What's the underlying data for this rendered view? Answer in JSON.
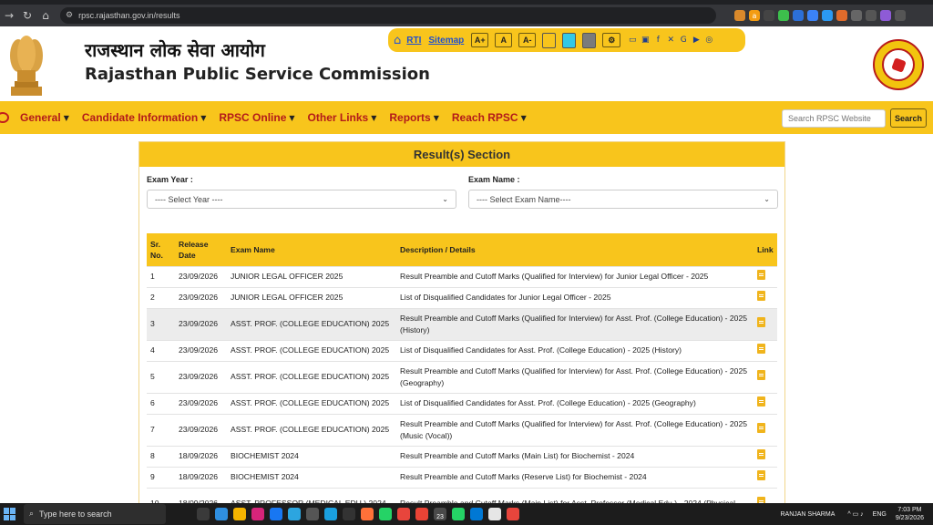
{
  "browser": {
    "url": "rpsc.rajasthan.gov.in/results"
  },
  "header": {
    "title_hindi": "राजस्थान लोक सेवा आयोग",
    "title_english": "Rajasthan Public Service Commission"
  },
  "toolbar": {
    "rti": "RTI",
    "sitemap": "Sitemap",
    "font_increase": "A+",
    "font_normal": "A",
    "font_decrease": "A-",
    "swatch_colors": [
      "#f8c51c",
      "#33c8e6",
      "#7b7b7b"
    ]
  },
  "nav": {
    "items": [
      "General",
      "Candidate Information",
      "RPSC Online",
      "Other Links",
      "Reports",
      "Reach RPSC"
    ],
    "search_placeholder": "Search RPSC Website",
    "search_button": "Search"
  },
  "results": {
    "section_title": "Result(s) Section",
    "exam_year_label": "Exam Year :",
    "exam_year_select": "---- Select Year ----",
    "exam_name_label": "Exam Name :",
    "exam_name_select": "---- Select Exam Name----",
    "columns": {
      "sr_line1": "Sr.",
      "sr_line2": "No.",
      "date_line1": "Release",
      "date_line2": "Date",
      "exam": "Exam Name",
      "desc": "Description / Details",
      "link": "Link"
    },
    "rows": [
      {
        "sr": "1",
        "date": "23/09/2026",
        "exam": "JUNIOR LEGAL OFFICER 2025",
        "desc": "Result Preamble and Cutoff Marks (Qualified for Interview) for Junior Legal Officer - 2025"
      },
      {
        "sr": "2",
        "date": "23/09/2026",
        "exam": "JUNIOR LEGAL OFFICER 2025",
        "desc": "List of Disqualified Candidates for Junior Legal Officer - 2025"
      },
      {
        "sr": "3",
        "date": "23/09/2026",
        "exam": "ASST. PROF. (COLLEGE EDUCATION) 2025",
        "desc": "Result Preamble and Cutoff Marks (Qualified for Interview) for Asst. Prof. (College Education) - 2025 (History)"
      },
      {
        "sr": "4",
        "date": "23/09/2026",
        "exam": "ASST. PROF. (COLLEGE EDUCATION) 2025",
        "desc": "List of Disqualified Candidates for Asst. Prof. (College Education) - 2025 (History)"
      },
      {
        "sr": "5",
        "date": "23/09/2026",
        "exam": "ASST. PROF. (COLLEGE EDUCATION) 2025",
        "desc": "Result Preamble and Cutoff Marks (Qualified for Interview) for Asst. Prof. (College Education) - 2025 (Geography)"
      },
      {
        "sr": "6",
        "date": "23/09/2026",
        "exam": "ASST. PROF. (COLLEGE EDUCATION) 2025",
        "desc": "List of Disqualified Candidates for Asst. Prof. (College Education) - 2025 (Geography)"
      },
      {
        "sr": "7",
        "date": "23/09/2026",
        "exam": "ASST. PROF. (COLLEGE EDUCATION) 2025",
        "desc": "Result Preamble and Cutoff Marks (Qualified for Interview) for Asst. Prof. (College Education) - 2025 (Music (Vocal))"
      },
      {
        "sr": "8",
        "date": "18/09/2026",
        "exam": "BIOCHEMIST 2024",
        "desc": "Result Preamble and Cutoff Marks (Main List) for Biochemist - 2024"
      },
      {
        "sr": "9",
        "date": "18/09/2026",
        "exam": "BIOCHEMIST 2024",
        "desc": "Result Preamble and Cutoff Marks (Reserve List) for Biochemist - 2024"
      },
      {
        "sr": "10",
        "date": "18/09/2026",
        "exam": "ASST. PROFESSOR (MEDICAL EDU.) 2024",
        "desc": "Result Preamble and Cutoff Marks (Main List) for Asst. Professor (Medical Edu.) - 2024 (Physical"
      }
    ]
  },
  "taskbar": {
    "search_placeholder": "Type here to search",
    "user": "RANJAN SHARMA",
    "lang": "ENG",
    "time": "7:03 PM",
    "date": "9/23/2026",
    "badge": "23"
  }
}
